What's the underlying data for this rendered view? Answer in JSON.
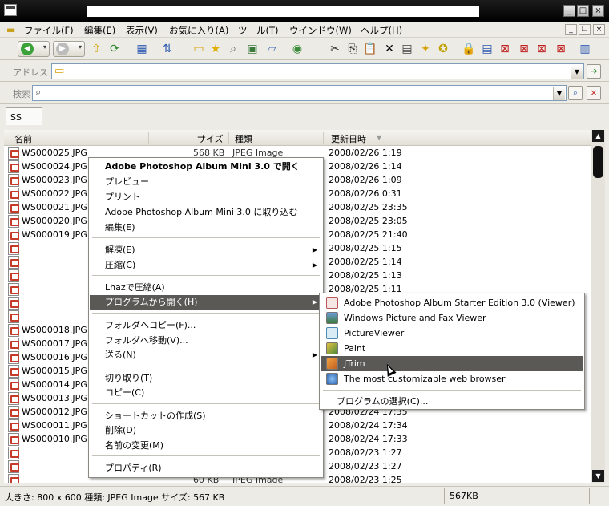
{
  "menubar": {
    "items": [
      "ファイル(F)",
      "編集(E)",
      "表示(V)",
      "お気に入り(A)",
      "ツール(T)",
      "ウインドウ(W)",
      "ヘルプ(H)"
    ]
  },
  "address": {
    "label": "アドレス",
    "value": ""
  },
  "search": {
    "label": "検索",
    "value": ""
  },
  "tab": {
    "label": "SS"
  },
  "columns": {
    "name": "名前",
    "size": "サイズ",
    "type": "種類",
    "modified": "更新日時"
  },
  "first_row": {
    "size": "568 KB",
    "type": "JPEG Image"
  },
  "last_row": {
    "size": "60 KB",
    "type": "JPEG Image"
  },
  "files": [
    {
      "name": "WS000025.JPG",
      "date": "2008/02/26 1:19"
    },
    {
      "name": "WS000024.JPG",
      "date": "2008/02/26 1:14"
    },
    {
      "name": "WS000023.JPG",
      "date": "2008/02/26 1:09"
    },
    {
      "name": "WS000022.JPG",
      "date": "2008/02/26 0:31"
    },
    {
      "name": "WS000021.JPG",
      "date": "2008/02/25 23:35"
    },
    {
      "name": "WS000020.JPG",
      "date": "2008/02/25 23:05"
    },
    {
      "name": "WS000019.JPG",
      "date": "2008/02/25 21:40"
    },
    {
      "name": "",
      "date": "2008/02/25 1:15"
    },
    {
      "name": "",
      "date": "2008/02/25 1:14"
    },
    {
      "name": "",
      "date": "2008/02/25 1:13"
    },
    {
      "name": "",
      "date": "2008/02/25 1:11"
    },
    {
      "name": "",
      "date": ""
    },
    {
      "name": "",
      "date": ""
    },
    {
      "name": "WS000018.JPG",
      "date": ""
    },
    {
      "name": "WS000017.JPG",
      "date": ""
    },
    {
      "name": "WS000016.JPG",
      "date": ""
    },
    {
      "name": "WS000015.JPG",
      "date": ""
    },
    {
      "name": "WS000014.JPG",
      "date": ""
    },
    {
      "name": "WS000013.JPG",
      "date": ""
    },
    {
      "name": "WS000012.JPG",
      "date": "2008/02/24 17:35"
    },
    {
      "name": "WS000011.JPG",
      "date": "2008/02/24 17:34"
    },
    {
      "name": "WS000010.JPG",
      "date": "2008/02/24 17:33"
    },
    {
      "name": "",
      "date": "2008/02/23 1:27"
    },
    {
      "name": "",
      "date": "2008/02/23 1:27"
    },
    {
      "name": "",
      "date": "2008/02/23 1:25"
    }
  ],
  "context_menu": {
    "open_with_photoshop": "Adobe Photoshop Album Mini 3.0 で開く",
    "preview": "プレビュー",
    "print": "プリント",
    "import_photoshop": "Adobe Photoshop Album Mini 3.0 に取り込む",
    "edit": "編集(E)",
    "extract": "解凍(E)",
    "compress": "圧縮(C)",
    "lhaz": "Lhazで圧縮(A)",
    "open_with": "プログラムから開く(H)",
    "copy_to_folder": "フォルダへコピー(F)...",
    "move_to_folder": "フォルダへ移動(V)...",
    "send_to": "送る(N)",
    "cut": "切り取り(T)",
    "copy": "コピー(C)",
    "create_shortcut": "ショートカットの作成(S)",
    "delete": "削除(D)",
    "rename": "名前の変更(M)",
    "properties": "プロパティ(R)"
  },
  "submenu": {
    "items": [
      "Adobe Photoshop Album Starter Edition 3.0 (Viewer)",
      "Windows Picture and Fax Viewer",
      "PictureViewer",
      "Paint",
      "JTrim",
      "The most customizable web browser"
    ],
    "choose_program": "プログラムの選択(C)..."
  },
  "status": {
    "details": "大きさ: 800 x 600 種類: JPEG Image サイズ: 567 KB",
    "size": "567KB"
  },
  "colors": {
    "highlight": "#5a5956",
    "window_bg": "#ecebe6",
    "titlebar": "#000000"
  }
}
